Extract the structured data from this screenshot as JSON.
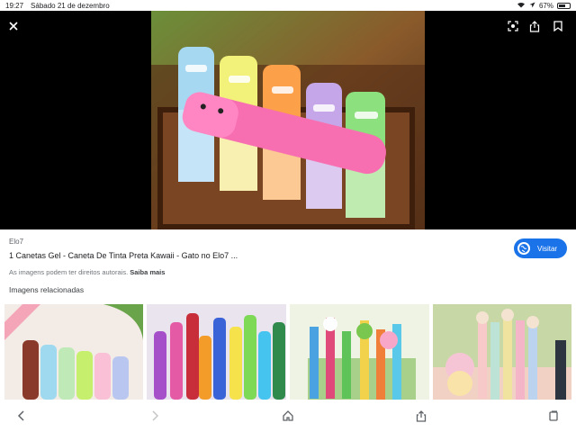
{
  "status": {
    "time": "19:27",
    "date": "Sábado 21 de dezembro",
    "battery": "67%",
    "battery_level": 0.67
  },
  "viewer": {
    "close_icon": "close-icon",
    "lens_icon": "lens-icon",
    "share_icon": "share-icon",
    "bookmark_icon": "bookmark-icon"
  },
  "result": {
    "source": "Elo7",
    "title": "1 Canetas Gel - Caneta De Tinta Preta Kawaii - Gato no Elo7 ...",
    "copyright": "As imagens podem ter direitos autorais.",
    "learn_more": "Saiba mais",
    "visit_label": "Visitar"
  },
  "related": {
    "title": "Imagens relacionadas"
  },
  "bottom_bar": {
    "icons": [
      "back-icon",
      "forward-icon",
      "home-icon",
      "share-icon",
      "tabs-icon"
    ]
  },
  "colors": {
    "accent": "#1a73e8",
    "viewer_bg": "#000000"
  }
}
